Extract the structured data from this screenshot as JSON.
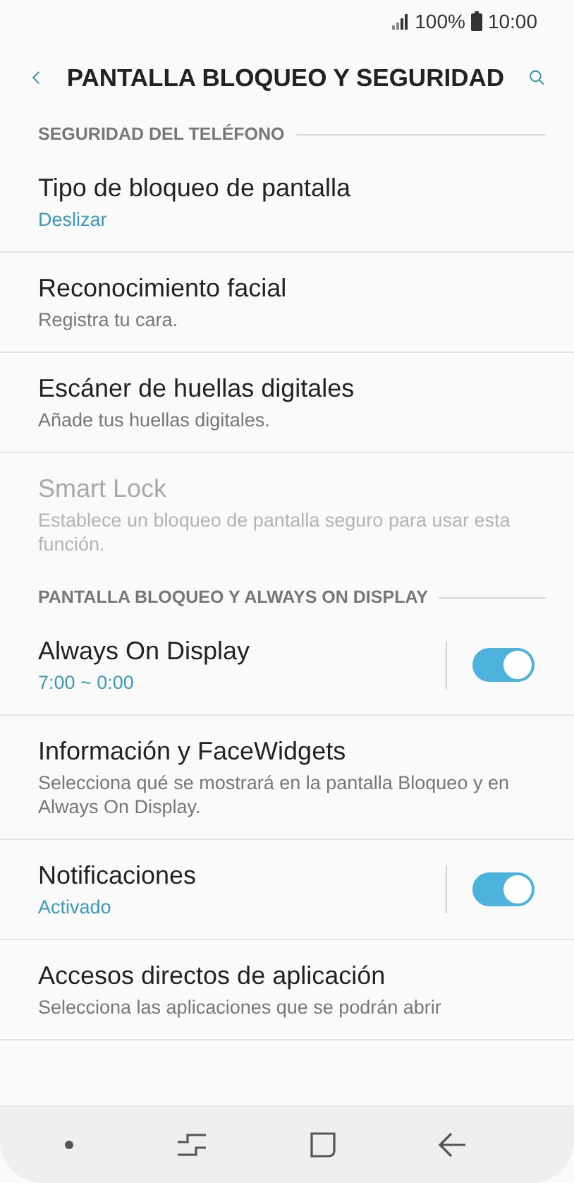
{
  "status_bar": {
    "battery": "100%",
    "time": "10:00"
  },
  "header": {
    "title": "PANTALLA BLOQUEO Y SEGURIDAD"
  },
  "sections": [
    {
      "title": "SEGURIDAD DEL TELÉFONO",
      "items": [
        {
          "kind": "link",
          "title": "Tipo de bloqueo de pantalla",
          "subtitle": "Deslizar",
          "subtitle_accent": true,
          "disabled": false
        },
        {
          "kind": "link",
          "title": "Reconocimiento facial",
          "subtitle": "Registra tu cara.",
          "subtitle_accent": false,
          "disabled": false
        },
        {
          "kind": "link",
          "title": "Escáner de huellas digitales",
          "subtitle": "Añade tus huellas digitales.",
          "subtitle_accent": false,
          "disabled": false
        },
        {
          "kind": "link",
          "title": "Smart Lock",
          "subtitle": "Establece un bloqueo de pantalla seguro para usar esta función.",
          "subtitle_accent": false,
          "disabled": true
        }
      ]
    },
    {
      "title": "PANTALLA BLOQUEO Y ALWAYS ON DISPLAY",
      "items": [
        {
          "kind": "toggle",
          "title": "Always On Display",
          "subtitle": "7:00 ~ 0:00",
          "subtitle_accent": true,
          "disabled": false,
          "on": true
        },
        {
          "kind": "link",
          "title": "Información y FaceWidgets",
          "subtitle": "Selecciona qué se mostrará en la pantalla Bloqueo y en Always On Display.",
          "subtitle_accent": false,
          "disabled": false
        },
        {
          "kind": "toggle",
          "title": "Notificaciones",
          "subtitle": "Activado",
          "subtitle_accent": true,
          "disabled": false,
          "on": true
        },
        {
          "kind": "link",
          "title": "Accesos directos de aplicación",
          "subtitle": "Selecciona las aplicaciones que se podrán abrir",
          "subtitle_accent": false,
          "disabled": false
        }
      ]
    }
  ]
}
